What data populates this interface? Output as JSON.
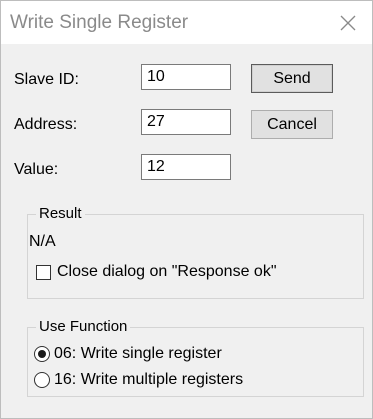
{
  "window": {
    "title": "Write Single Register"
  },
  "fields": {
    "slave_id": {
      "label": "Slave ID:",
      "value": "10"
    },
    "address": {
      "label": "Address:",
      "value": "27"
    },
    "value": {
      "label": "Value:",
      "value": "12"
    }
  },
  "buttons": {
    "send_label": "Send",
    "cancel_label": "Cancel"
  },
  "result": {
    "legend": "Result",
    "status": "N/A",
    "close_on_ok_label": "Close dialog on \"Response ok\"",
    "close_on_ok_checked": false
  },
  "use_function": {
    "legend": "Use Function",
    "options": [
      {
        "label": "06: Write single register",
        "selected": true
      },
      {
        "label": "16: Write multiple registers",
        "selected": false
      }
    ]
  },
  "icons": {
    "close": "close-icon"
  }
}
